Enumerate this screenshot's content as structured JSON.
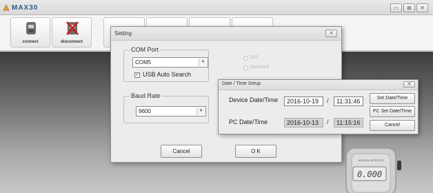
{
  "app": {
    "title": "MAX30"
  },
  "window_controls": {
    "minimize": "▭",
    "maximize": "⊞",
    "close": "✕"
  },
  "toolbar": {
    "connect_label": "connect",
    "disconnect_label": "disconnect"
  },
  "setting_dialog": {
    "title": "Setting",
    "com_port": {
      "group_label": "COM Port",
      "selected": "COM5",
      "usb_auto_search_label": "USB Auto Search",
      "usb_auto_search_checked": true
    },
    "radio_options": [
      "SV0",
      "Standard"
    ],
    "baud_rate": {
      "group_label": "Baud Rate",
      "selected": "9600"
    },
    "cancel_label": "Cancel",
    "ok_label": "O K"
  },
  "datetime_dialog": {
    "title": "Date / Time Setup",
    "device_label": "Device Date/Time",
    "device_date": "2016-10-19",
    "device_time": "11:31:46",
    "pc_label": "PC  Date/Time",
    "pc_date": "2016-10-13",
    "pc_time": "11:15:16",
    "separator": "/",
    "set_button": "Set Date/Time",
    "pc_set_button": "PC Set Date/Time",
    "cancel_button": "Cancel"
  },
  "device": {
    "display_value": "0.000",
    "brand": "ALCOHOL DETECTOR"
  },
  "colors": {
    "title_text": "#2e5a86",
    "background_dark": "#3d3d3d",
    "readonly_field": "#d3d3d3"
  }
}
